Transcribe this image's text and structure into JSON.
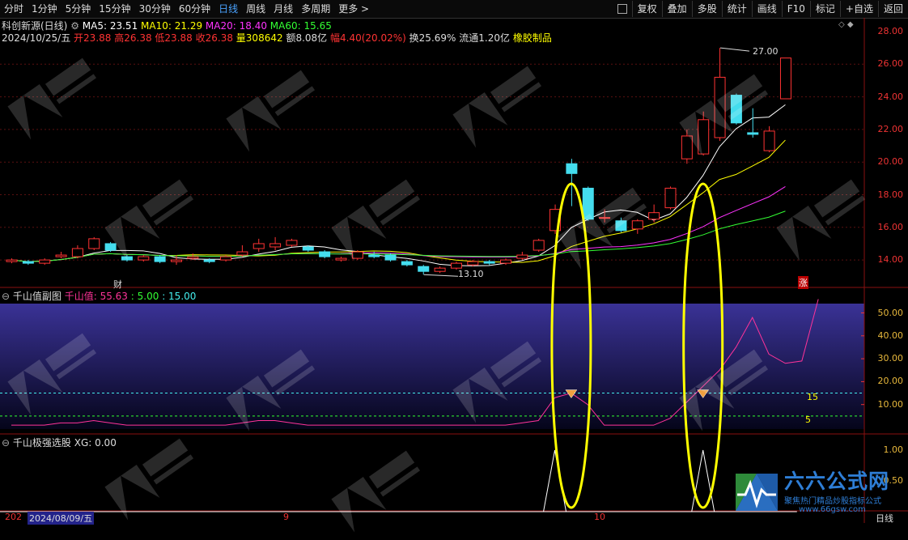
{
  "toolbar": {
    "tabs": [
      "分时",
      "1分钟",
      "5分钟",
      "15分钟",
      "30分钟",
      "60分钟",
      "日线",
      "周线",
      "月线",
      "多周期",
      "更多 >"
    ],
    "active_tab": "日线",
    "tools": [
      "复权",
      "叠加",
      "多股",
      "统计",
      "画线",
      "F10",
      "标记",
      "+自选",
      "返回"
    ]
  },
  "header": {
    "stock_name": "科创新源(日线)",
    "ma5": "MA5: 23.51",
    "ma10": "MA10: 21.29",
    "ma20": "MA20: 18.40",
    "ma60": "MA60: 15.65",
    "date": "2024/10/25/五",
    "open": "开23.88",
    "high": "高26.38",
    "low": "低23.88",
    "close": "收26.38",
    "volume": "量308642",
    "amount": "额8.08亿",
    "change": "幅4.40(20.02%)",
    "turnover": "换25.69%",
    "float_cap": "流通1.20亿",
    "sector": "橡胶制品"
  },
  "main_axis": [
    "28.00",
    "26.00",
    "24.00",
    "22.00",
    "20.00",
    "18.00",
    "16.00",
    "14.00"
  ],
  "annotations": {
    "high_price": "27.00",
    "low_price": "13.10",
    "fin_marker": "财",
    "limit_marker": "涨"
  },
  "sub1": {
    "title": "千山值副图",
    "value_label": "千山值: 55.63",
    "v5": ": 5.00",
    "v15": ": 15.00",
    "axis": [
      "50.00",
      "40.00",
      "30.00",
      "20.00",
      "10.00"
    ],
    "line15_label": "15",
    "line5_label": "5"
  },
  "sub2": {
    "title": "千山极强选股",
    "xg_label": "XG: 0.00",
    "axis": [
      "1.00",
      "0.50"
    ]
  },
  "bottom": {
    "date_left": "2024/08/09/五",
    "year_frag": "202",
    "month9": "9",
    "month10": "10",
    "period": "日线"
  },
  "logo": {
    "main": "六六公式网",
    "sub": "聚焦热门精品炒股指标公式",
    "url": "www.66gsw.com"
  },
  "colors": {
    "up": "#ff3333",
    "down": "#44ddee",
    "ma5": "#ffffff",
    "ma10": "#ffff00",
    "ma20": "#ff33ff",
    "ma60": "#33ff33",
    "qsz": "#ff3399"
  },
  "candles": [
    {
      "o": 13.9,
      "c": 14.0,
      "h": 14.1,
      "l": 13.8
    },
    {
      "o": 13.9,
      "c": 13.8,
      "h": 14.0,
      "l": 13.7
    },
    {
      "o": 13.8,
      "c": 14.0,
      "h": 14.1,
      "l": 13.7
    },
    {
      "o": 14.2,
      "c": 14.3,
      "h": 14.5,
      "l": 14.1
    },
    {
      "o": 14.2,
      "c": 14.7,
      "h": 14.9,
      "l": 14.1
    },
    {
      "o": 14.7,
      "c": 15.3,
      "h": 15.4,
      "l": 14.6
    },
    {
      "o": 15.0,
      "c": 14.6,
      "h": 15.1,
      "l": 14.5
    },
    {
      "o": 14.2,
      "c": 14.0,
      "h": 14.3,
      "l": 13.9
    },
    {
      "o": 14.0,
      "c": 14.2,
      "h": 14.3,
      "l": 13.9
    },
    {
      "o": 14.2,
      "c": 13.9,
      "h": 14.3,
      "l": 13.8
    },
    {
      "o": 13.9,
      "c": 14.0,
      "h": 14.3,
      "l": 13.7
    },
    {
      "o": 14.1,
      "c": 14.2,
      "h": 14.4,
      "l": 14.0
    },
    {
      "o": 14.0,
      "c": 13.9,
      "h": 14.1,
      "l": 13.8
    },
    {
      "o": 14.0,
      "c": 14.2,
      "h": 14.3,
      "l": 13.9
    },
    {
      "o": 14.3,
      "c": 14.5,
      "h": 14.9,
      "l": 14.2
    },
    {
      "o": 14.7,
      "c": 15.0,
      "h": 15.3,
      "l": 14.5
    },
    {
      "o": 14.8,
      "c": 15.0,
      "h": 15.4,
      "l": 14.6
    },
    {
      "o": 14.9,
      "c": 15.2,
      "h": 15.3,
      "l": 14.8
    },
    {
      "o": 14.8,
      "c": 14.6,
      "h": 14.9,
      "l": 14.5
    },
    {
      "o": 14.5,
      "c": 14.2,
      "h": 14.6,
      "l": 14.1
    },
    {
      "o": 14.0,
      "c": 14.1,
      "h": 14.2,
      "l": 13.9
    },
    {
      "o": 14.1,
      "c": 14.5,
      "h": 14.6,
      "l": 14.0
    },
    {
      "o": 14.3,
      "c": 14.2,
      "h": 14.5,
      "l": 14.1
    },
    {
      "o": 14.3,
      "c": 14.0,
      "h": 14.4,
      "l": 13.9
    },
    {
      "o": 13.9,
      "c": 13.7,
      "h": 14.0,
      "l": 13.6
    },
    {
      "o": 13.6,
      "c": 13.3,
      "h": 13.7,
      "l": 13.1
    },
    {
      "o": 13.3,
      "c": 13.5,
      "h": 13.6,
      "l": 13.2
    },
    {
      "o": 13.5,
      "c": 13.8,
      "h": 13.9,
      "l": 13.4
    },
    {
      "o": 13.7,
      "c": 13.9,
      "h": 14.0,
      "l": 13.6
    },
    {
      "o": 13.9,
      "c": 13.8,
      "h": 14.0,
      "l": 13.7
    },
    {
      "o": 13.8,
      "c": 14.0,
      "h": 14.1,
      "l": 13.7
    },
    {
      "o": 14.1,
      "c": 14.3,
      "h": 14.5,
      "l": 14.0
    },
    {
      "o": 14.6,
      "c": 15.2,
      "h": 15.3,
      "l": 14.5
    },
    {
      "o": 15.8,
      "c": 17.1,
      "h": 17.4,
      "l": 15.6
    },
    {
      "o": 19.9,
      "c": 19.3,
      "h": 20.2,
      "l": 17.3
    },
    {
      "o": 18.4,
      "c": 16.5,
      "h": 18.5,
      "l": 16.4
    },
    {
      "o": 16.6,
      "c": 16.6,
      "h": 17.1,
      "l": 16.3
    },
    {
      "o": 16.4,
      "c": 15.8,
      "h": 16.6,
      "l": 15.7
    },
    {
      "o": 15.9,
      "c": 16.4,
      "h": 16.5,
      "l": 15.6
    },
    {
      "o": 16.5,
      "c": 16.9,
      "h": 17.4,
      "l": 16.3
    },
    {
      "o": 17.2,
      "c": 18.4,
      "h": 18.5,
      "l": 17.1
    },
    {
      "o": 20.2,
      "c": 21.6,
      "h": 22.0,
      "l": 19.9
    },
    {
      "o": 20.5,
      "c": 22.6,
      "h": 23.1,
      "l": 20.4
    },
    {
      "o": 21.5,
      "c": 25.2,
      "h": 27.0,
      "l": 21.3
    },
    {
      "o": 24.1,
      "c": 22.4,
      "h": 24.2,
      "l": 22.3
    },
    {
      "o": 21.8,
      "c": 21.7,
      "h": 23.3,
      "l": 21.5
    },
    {
      "o": 20.7,
      "c": 21.9,
      "h": 22.2,
      "l": 20.6
    },
    {
      "o": 23.88,
      "c": 26.38,
      "h": 26.38,
      "l": 23.88
    }
  ],
  "qsz_series": [
    1,
    1,
    1,
    2,
    2,
    3,
    2,
    1,
    1,
    1,
    1,
    1,
    1,
    1,
    2,
    3,
    3,
    2,
    1,
    1,
    1,
    1,
    1,
    1,
    1,
    1,
    1,
    1,
    1,
    1,
    1,
    2,
    3,
    13,
    15,
    10,
    1,
    1,
    1,
    1,
    4,
    11,
    18,
    25,
    35,
    48,
    32,
    28,
    29,
    56
  ],
  "xg_series": [
    0,
    0,
    0,
    0,
    0,
    0,
    0,
    0,
    0,
    0,
    0,
    0,
    0,
    0,
    0,
    0,
    0,
    0,
    0,
    0,
    0,
    0,
    0,
    0,
    0,
    0,
    0,
    0,
    0,
    0,
    0,
    0,
    0,
    1,
    0,
    0,
    0,
    0,
    0,
    0,
    0,
    0,
    1,
    0,
    0,
    0,
    0,
    0,
    0,
    0
  ],
  "signal_points": [
    34,
    42
  ]
}
